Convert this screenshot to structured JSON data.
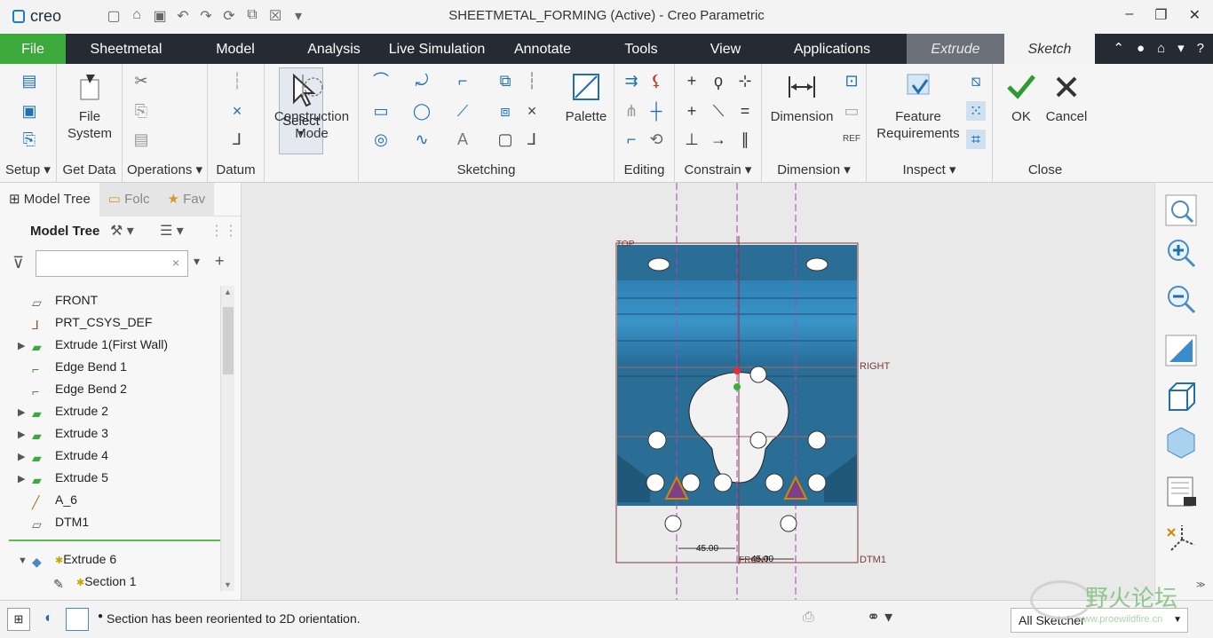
{
  "app": {
    "logo": "creo",
    "window_title": "SHEETMETAL_FORMING (Active) - Creo Parametric"
  },
  "menu": {
    "file": "File",
    "items": [
      "Sheetmetal",
      "Model",
      "Analysis",
      "Live Simulation",
      "Annotate",
      "Tools",
      "View",
      "Applications"
    ],
    "extrude_tab": "Extrude",
    "sketch_tab": "Sketch"
  },
  "ribbon": {
    "setup": "Setup",
    "get_data": "Get Data",
    "file_system_line1": "File",
    "file_system_line2": "System",
    "operations": "Operations",
    "select": "Select",
    "datum": "Datum",
    "construction_line1": "Construction",
    "construction_line2": "Mode",
    "sketching": "Sketching",
    "palette": "Palette",
    "editing": "Editing",
    "constrain": "Constrain",
    "dimension_btn": "Dimension",
    "dimension_group": "Dimension",
    "feature_req_line1": "Feature",
    "feature_req_line2": "Requirements",
    "inspect": "Inspect",
    "ok": "OK",
    "cancel": "Cancel",
    "close": "Close"
  },
  "left_panel": {
    "tabs": [
      "Model Tree",
      "Folc",
      "Fav"
    ],
    "header": "Model Tree",
    "filter_placeholder": "",
    "tree": [
      {
        "label": "FRONT",
        "icon": "plane-icon",
        "expandable": false
      },
      {
        "label": "PRT_CSYS_DEF",
        "icon": "csys-icon",
        "expandable": false
      },
      {
        "label": "Extrude 1(First Wall)",
        "icon": "first-wall-icon",
        "expandable": true
      },
      {
        "label": "Edge Bend 1",
        "icon": "edge-bend-icon",
        "expandable": false
      },
      {
        "label": "Edge Bend 2",
        "icon": "edge-bend-icon",
        "expandable": false
      },
      {
        "label": "Extrude 2",
        "icon": "extrude-icon",
        "expandable": true
      },
      {
        "label": "Extrude 3",
        "icon": "extrude-icon",
        "expandable": true
      },
      {
        "label": "Extrude 4",
        "icon": "extrude-icon",
        "expandable": true
      },
      {
        "label": "Extrude 5",
        "icon": "extrude-icon",
        "expandable": true
      },
      {
        "label": "A_6",
        "icon": "axis-icon",
        "expandable": false
      },
      {
        "label": "DTM1",
        "icon": "plane-icon",
        "expandable": false
      }
    ],
    "active_tree": [
      {
        "label": "Extrude 6",
        "icon": "extrude-active-icon",
        "expandable": true
      },
      {
        "label": "Section 1",
        "icon": "section-icon",
        "expandable": false
      }
    ]
  },
  "canvas": {
    "labels": {
      "top": "TOP",
      "right": "RIGHT",
      "front": "FRONT",
      "dtm1": "DTM1",
      "dim_left": "45.00",
      "dim_right": "45.00"
    }
  },
  "status": {
    "message": "Section has been reoriented to 2D orientation.",
    "filter": "All Sketcher"
  },
  "watermark": {
    "text": "野火论坛",
    "url": "www.proewildfire.cn"
  },
  "colors": {
    "accent_green": "#3ca93c",
    "menubar": "#262b33",
    "part_blue": "#2a6e96"
  }
}
